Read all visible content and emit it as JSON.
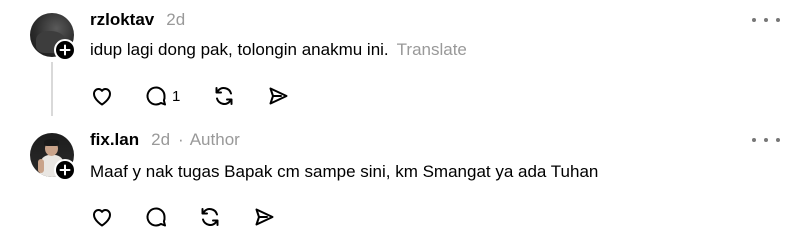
{
  "comments": [
    {
      "username": "rzloktav",
      "time": "2d",
      "author_tag": "",
      "text": "idup lagi dong pak, tolongin anakmu ini.",
      "translate_label": "Translate",
      "reply_count": "1",
      "has_thread_line": true
    },
    {
      "username": "fix.lan",
      "time": "2d",
      "separator": "·",
      "author_tag": "Author",
      "text": "Maaf y nak tugas Bapak cm sampe sini, km Smangat ya ada Tuhan",
      "translate_label": "",
      "reply_count": "",
      "has_thread_line": false
    }
  ],
  "icons": {
    "like": "heart-icon",
    "reply": "comment-bubble-icon",
    "repost": "repost-arrows-icon",
    "share": "send-paper-plane-icon",
    "more": "more-dots-icon",
    "follow": "plus-icon"
  },
  "colors": {
    "text": "#000000",
    "muted": "#999999",
    "icon": "#000000",
    "thread_line": "#d9d9d9"
  }
}
